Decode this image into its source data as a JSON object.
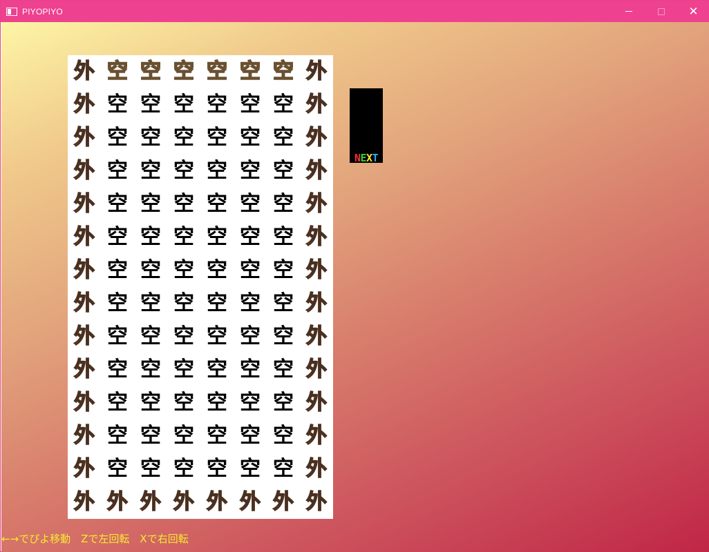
{
  "window": {
    "title": "PIYOPIYO",
    "titlebar_color": "#ee4190",
    "controls": {
      "minimize_icon": "minimize-icon",
      "maximize_icon": "maximize-icon",
      "close_icon": "close-icon"
    }
  },
  "game": {
    "board": {
      "columns": 8,
      "rows": 14,
      "empty_glyph": "空",
      "wall_glyph": "外",
      "cells": [
        [
          "外",
          "空",
          "空",
          "空",
          "空",
          "空",
          "空",
          "外"
        ],
        [
          "外",
          "空",
          "空",
          "空",
          "空",
          "空",
          "空",
          "外"
        ],
        [
          "外",
          "空",
          "空",
          "空",
          "空",
          "空",
          "空",
          "外"
        ],
        [
          "外",
          "空",
          "空",
          "空",
          "空",
          "空",
          "空",
          "外"
        ],
        [
          "外",
          "空",
          "空",
          "空",
          "空",
          "空",
          "空",
          "外"
        ],
        [
          "外",
          "空",
          "空",
          "空",
          "空",
          "空",
          "空",
          "外"
        ],
        [
          "外",
          "空",
          "空",
          "空",
          "空",
          "空",
          "空",
          "外"
        ],
        [
          "外",
          "空",
          "空",
          "空",
          "空",
          "空",
          "空",
          "外"
        ],
        [
          "外",
          "空",
          "空",
          "空",
          "空",
          "空",
          "空",
          "外"
        ],
        [
          "外",
          "空",
          "空",
          "空",
          "空",
          "空",
          "空",
          "外"
        ],
        [
          "外",
          "空",
          "空",
          "空",
          "空",
          "空",
          "空",
          "外"
        ],
        [
          "外",
          "空",
          "空",
          "空",
          "空",
          "空",
          "空",
          "外"
        ],
        [
          "外",
          "空",
          "空",
          "空",
          "空",
          "空",
          "空",
          "外"
        ],
        [
          "外",
          "外",
          "外",
          "外",
          "外",
          "外",
          "外",
          "外"
        ]
      ]
    },
    "next": {
      "letters": [
        "N",
        "E",
        "X",
        "T"
      ],
      "letter_colors": [
        "#f0303a",
        "#30d040",
        "#f8e830",
        "#30a8f8"
      ]
    },
    "help_text": "←→でぴよ移動　Zで左回転　Xで右回転",
    "help_color": "#f7ea2f",
    "wall_colors_top_to_bottom": [
      "#f7dca8",
      "#f2a27e",
      "#e4665d"
    ]
  }
}
